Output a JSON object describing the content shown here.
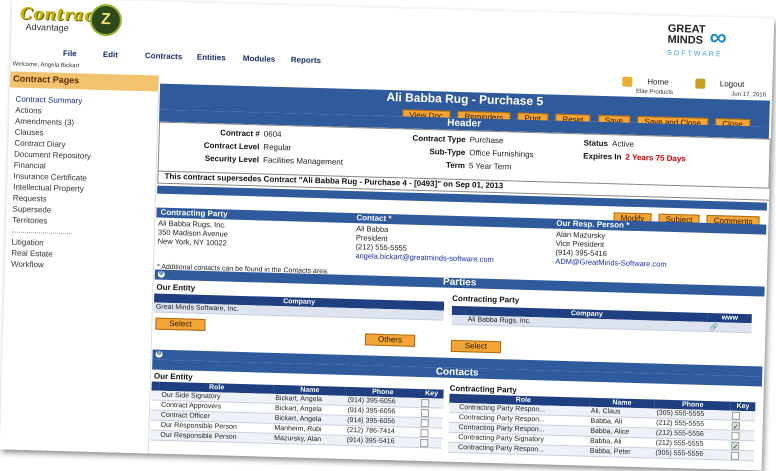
{
  "app": {
    "logo_main": "Contract",
    "logo_sub": "Advantage",
    "logo_badge": "Z",
    "vendor_line1": "GREAT",
    "vendor_line2": "MINDS",
    "vendor_line3": "SOFTWARE",
    "welcome": "Welcome, Angela Bickart"
  },
  "menu": [
    "File",
    "Edit",
    "Contracts",
    "Entities",
    "Modules",
    "Reports"
  ],
  "top_actions": {
    "home": "Home",
    "logout": "Logout"
  },
  "info": {
    "company": "Elite Products",
    "date": "Jun 17, 2016"
  },
  "sidebar": {
    "heading": "Contract Pages",
    "items": [
      "Contract Summary",
      "Actions",
      "Amendments (3)",
      "Clauses",
      "Contract Diary",
      "Document Repository",
      "Financial",
      "Insurance Certificate",
      "Intellectual Property",
      "Requests",
      "Supersede",
      "Territories",
      "Litigation",
      "Real Estate",
      "Workflow"
    ]
  },
  "contract": {
    "title": "Ali Babba Rug - Purchase 5",
    "buttons": [
      "View Doc",
      "Reminders",
      "Print",
      "Reset",
      "Save",
      "Save and Close",
      "Close"
    ]
  },
  "header": {
    "section_title": "Header",
    "contract_no_label": "Contract #",
    "contract_no": "0604",
    "level_label": "Contract Level",
    "level": "Regular",
    "security_label": "Security Level",
    "security": "Facilities Management",
    "type_label": "Contract Type",
    "type": "Purchase",
    "subtype_label": "Sub-Type",
    "subtype": "Office Furnishings",
    "term_label": "Term",
    "term": "5 Year Term",
    "status_label": "Status",
    "status": "Active",
    "expires_label": "Expires In",
    "expires": "2 Years 75 Days",
    "supersedes": "This contract supersedes Contract \"Ali Babba Rug - Purchase 4 - [0493]\" on Sep 01, 2013"
  },
  "action_buttons": [
    "Modify",
    "Subject",
    "Comments"
  ],
  "contracting_party": {
    "heading": "Contracting Party",
    "contact_heading": "Contact *",
    "resp_heading": "Our Resp. Person *",
    "party_lines": [
      "Ali Babba Rugs, Inc.",
      "350 Madison Avenue",
      "New York, NY 10022"
    ],
    "contact_lines": [
      "Ali Babba",
      "President",
      "(212) 555-5555"
    ],
    "contact_email": "angela.bickart@greatminds-software.com",
    "resp_lines": [
      "Alan Mazursky",
      "Vice President",
      "(914) 395-5416"
    ],
    "resp_email": "ADM@GreatMinds-Software.com",
    "note": "* Additional contacts can be found in the Contacts area."
  },
  "parties": {
    "section_title": "Parties",
    "our_entity": "Our Entity",
    "contracting_party": "Contracting Party",
    "company_col": "Company",
    "www_col": "www",
    "our_company": "Great Minds Software, Inc.",
    "their_company": "Ali Babba Rugs, Inc.",
    "select": "Select",
    "others": "Others"
  },
  "contacts": {
    "section_title": "Contacts",
    "our_entity": "Our Entity",
    "contracting_party": "Contracting Party",
    "cols": [
      "Role",
      "Name",
      "Phone",
      "Key"
    ],
    "ours": [
      {
        "role": "Our Side Signatory",
        "name": "Bickart, Angela",
        "phone": "(914) 395-6056",
        "key": false
      },
      {
        "role": "Contract Approvers",
        "name": "Bickart, Angela",
        "phone": "(914) 395-6056",
        "key": false
      },
      {
        "role": "Contract Officer",
        "name": "Bickart, Angela",
        "phone": "(914) 395-6056",
        "key": false
      },
      {
        "role": "Our Responsible Person",
        "name": "Manheim, Rubi",
        "phone": "(212) 786-7414",
        "key": false
      },
      {
        "role": "Our Responsible Person",
        "name": "Mazursky, Alan",
        "phone": "(914) 395-5416",
        "key": false
      }
    ],
    "theirs": [
      {
        "role": "Contracting Party Respon...",
        "name": "Ali, Claus",
        "phone": "(305) 555-5555",
        "key": false
      },
      {
        "role": "Contracting Party Respon...",
        "name": "Babba, Ali",
        "phone": "(212) 555-5555",
        "key": true
      },
      {
        "role": "Contracting Party Respon...",
        "name": "Babba, Alice",
        "phone": "(212) 555-5556",
        "key": false
      },
      {
        "role": "Contracting Party Signatory",
        "name": "Babba, Ali",
        "phone": "(212) 555-5555",
        "key": true
      },
      {
        "role": "Contracting Party Respon...",
        "name": "Babba, Peter",
        "phone": "(305) 555-5556",
        "key": false
      }
    ]
  }
}
